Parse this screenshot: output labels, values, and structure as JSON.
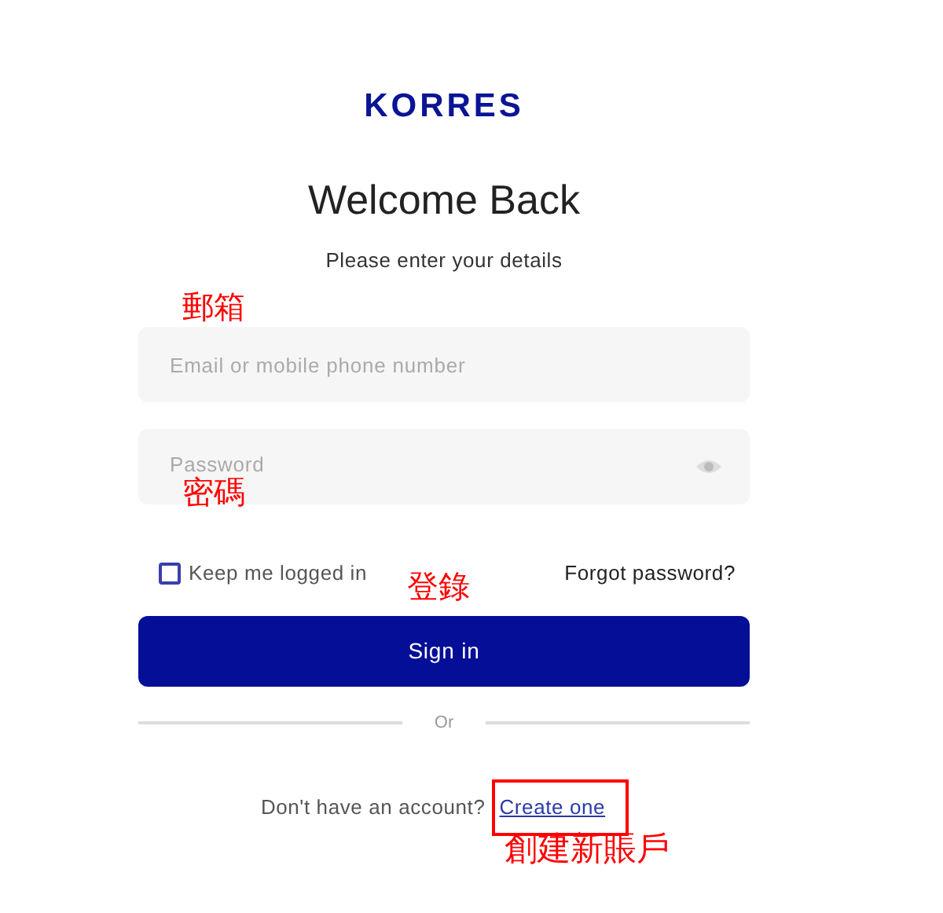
{
  "brand": "KORRES",
  "title": "Welcome Back",
  "subtitle": "Please enter your details",
  "email_field": {
    "placeholder": "Email or mobile phone number",
    "annotation": "郵箱"
  },
  "password_field": {
    "placeholder": "Password",
    "annotation": "密碼"
  },
  "remember": {
    "label": "Keep me logged in",
    "checked": false
  },
  "forgot_link": "Forgot password?",
  "sign_in_button": {
    "label": "Sign in",
    "annotation": "登錄"
  },
  "divider": "Or",
  "signup": {
    "prompt": "Don't have an account?",
    "link": "Create one",
    "annotation": "創建新賬戶"
  }
}
